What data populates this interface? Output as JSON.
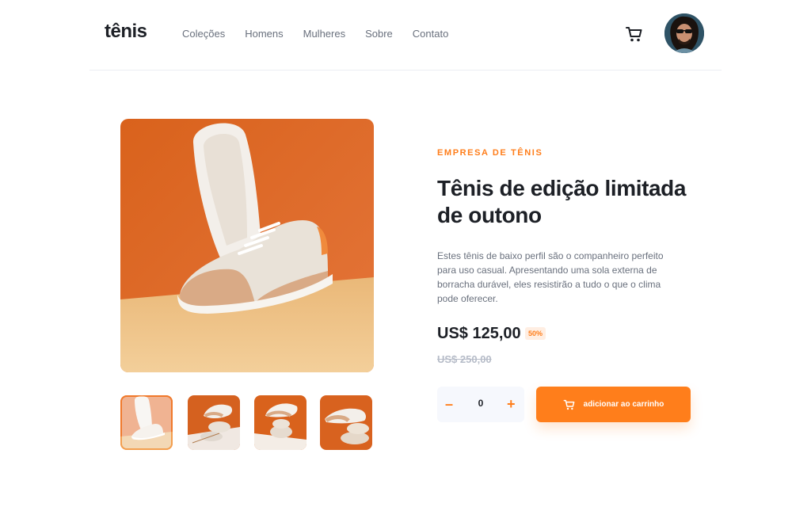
{
  "header": {
    "logo": "tênis",
    "nav": [
      "Coleções",
      "Homens",
      "Mulheres",
      "Sobre",
      "Contato"
    ]
  },
  "product": {
    "company": "EMPRESA DE TÊNIS",
    "title": "Tênis de edição limitada de outono",
    "description": "Estes tênis de baixo perfil são o companheiro perfeito para uso casual. Apresentando uma sola externa de borracha durável, eles resistirão a tudo o que o clima pode oferecer.",
    "price": "US$ 125,00",
    "discount": "50%",
    "old_price": "US$ 250,00",
    "quantity": "0",
    "minus": "–",
    "plus": "+",
    "add_label": "adicionar ao carrinho"
  },
  "colors": {
    "accent": "#ff7e1b",
    "dark": "#1d2026",
    "gray": "#69707d"
  }
}
